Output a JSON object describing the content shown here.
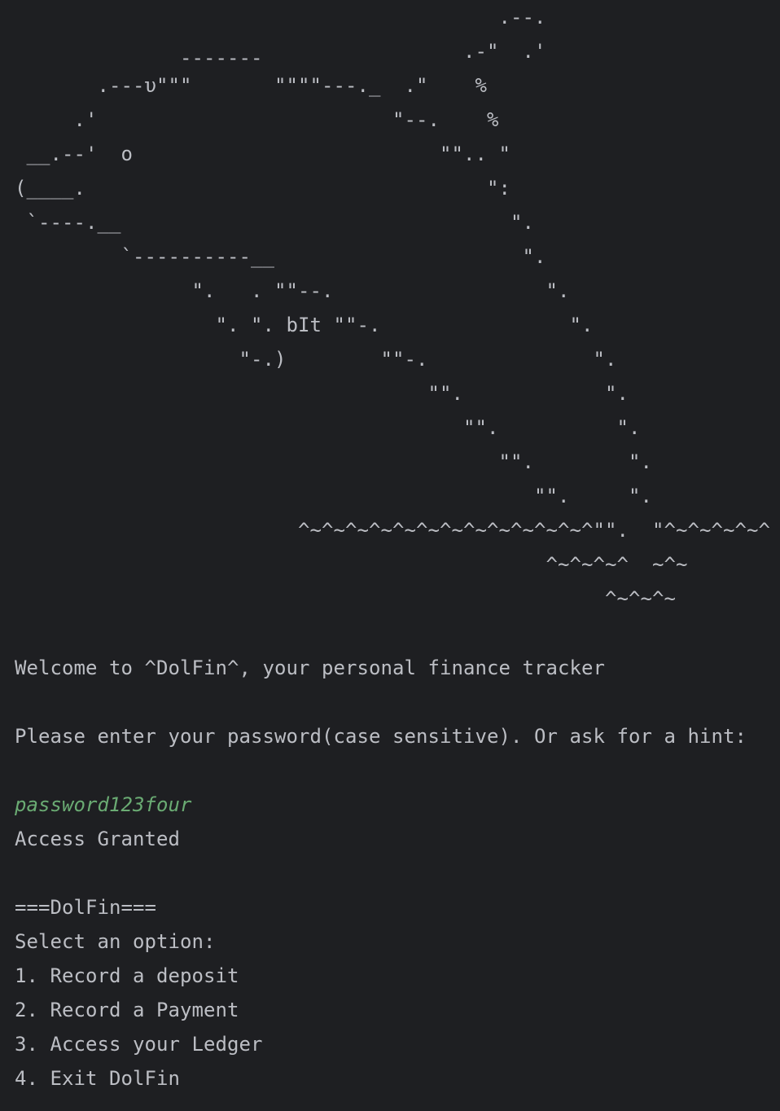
{
  "colors": {
    "background": "#1e1f22",
    "foreground": "#bcbec4",
    "user_input": "#6aab73"
  },
  "ascii_art": [
    "                                         .--.",
    "                                      .-\"  .'",
    "              -------",
    "       .---υ\"\"\"       \"\"\"\"---._  .\"    %",
    "     .'                         \"--.    %",
    " __.--'  o                          \"\".. \"",
    "(____.                                  \":",
    " `----.__                                 \".",
    "         `----------__                     \".",
    "               \".   . \"\"--.                  \".",
    "                 \". \". bIt \"\"-.                \".",
    "                   \"-.)        \"\"-.              \".",
    "                                   \"\".            \".",
    "                                      \"\".          \".",
    "                                         \"\".        \".",
    "                                            \"\".     \".",
    "                        ^~^~^~^~^~^~^~^~^~^~^~^~^\"\".  \"^~^~^~^~^",
    "                                             ^~^~^~^  ~^~",
    "                                                  ^~^~^~"
  ],
  "console": {
    "welcome": "Welcome to ^DolFin^, your personal finance tracker",
    "password_prompt": "Please enter your password(case sensitive). Or ask for a hint:",
    "password_entered": "password123four",
    "access_result": "Access Granted",
    "menu_title": "===DolFin===",
    "menu_prompt": "Select an option:",
    "menu_options": [
      "1. Record a deposit",
      "2. Record a Payment",
      "3. Access your Ledger",
      "4. Exit DolFin"
    ]
  }
}
